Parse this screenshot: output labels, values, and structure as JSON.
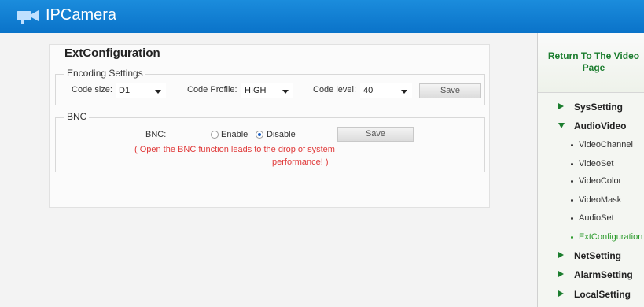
{
  "header": {
    "brand": "IPCamera",
    "logo_icon": "camera-icon"
  },
  "page": {
    "title": "ExtConfiguration",
    "encoding": {
      "legend": "Encoding Settings",
      "code_size_label": "Code size:",
      "code_size_value": "D1",
      "code_profile_label": "Code Profile:",
      "code_profile_value": "HIGH",
      "code_level_label": "Code level:",
      "code_level_value": "40",
      "save_label": "Save"
    },
    "bnc": {
      "legend": "BNC",
      "label": "BNC:",
      "enable_label": "Enable",
      "disable_label": "Disable",
      "selected": "Disable",
      "save_label": "Save",
      "warning_line1": "( Open the BNC function leads to the drop of system",
      "warning_line2": "performance! )"
    }
  },
  "sidebar": {
    "return_line1": "Return To The Video",
    "return_line2": "Page",
    "groups": [
      {
        "label": "SysSetting",
        "expanded": false
      },
      {
        "label": "AudioVideo",
        "expanded": true,
        "items": [
          "VideoChannel",
          "VideoSet",
          "VideoColor",
          "VideoMask",
          "AudioSet",
          "ExtConfiguration"
        ],
        "active": "ExtConfiguration"
      },
      {
        "label": "NetSetting",
        "expanded": false
      },
      {
        "label": "AlarmSetting",
        "expanded": false
      },
      {
        "label": "LocalSetting",
        "expanded": false
      }
    ]
  },
  "colors": {
    "header_blue": "#0a73c9",
    "accent_green": "#1b7d2e",
    "warning_red": "#e03a3a",
    "active_item": "#2a9a2a"
  }
}
